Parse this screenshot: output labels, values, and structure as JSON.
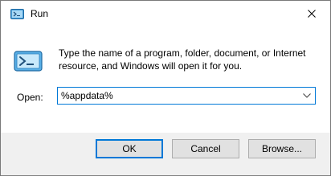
{
  "window": {
    "title": "Run"
  },
  "icons": {
    "title_icon": "run-icon",
    "body_icon": "run-icon",
    "close_icon": "close-icon",
    "dropdown_icon": "chevron-down-icon"
  },
  "message": "Type the name of a program, folder, document, or Internet resource, and Windows will open it for you.",
  "open": {
    "label": "Open:",
    "value": "%appdata%"
  },
  "buttons": {
    "ok": "OK",
    "cancel": "Cancel",
    "browse": "Browse..."
  },
  "colors": {
    "accent": "#0078d7",
    "footer_bg": "#f0f0f0",
    "button_bg": "#e1e1e1"
  }
}
